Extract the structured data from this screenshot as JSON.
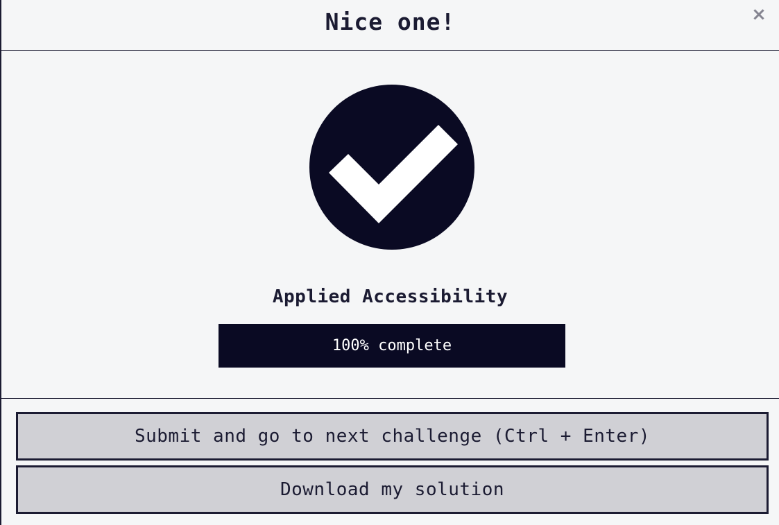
{
  "modal": {
    "title": "Nice one!",
    "close_label": "×"
  },
  "completion": {
    "block_title": "Applied Accessibility",
    "progress_percent": 100,
    "progress_text": "100% complete"
  },
  "actions": {
    "submit_label": "Submit and go to next challenge (Ctrl + Enter)",
    "download_label": "Download my solution"
  },
  "icons": {
    "success": "check-circle-icon",
    "close": "close-icon"
  },
  "colors": {
    "primary": "#0a0a23",
    "text": "#1b1b32",
    "button_bg": "#d0d0d5",
    "background": "#f5f6f7",
    "close_icon": "#858591"
  }
}
